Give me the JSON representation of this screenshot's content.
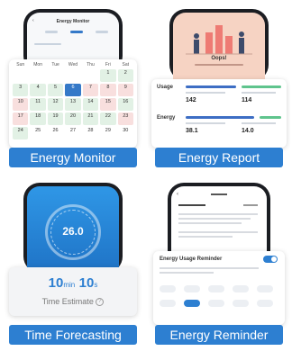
{
  "energy_monitor": {
    "caption": "Energy Monitor",
    "screen_title": "Energy Monitor",
    "weekdays": [
      "Sun",
      "Mon",
      "Tue",
      "Wed",
      "Thu",
      "Fri",
      "Sat"
    ],
    "days": [
      {
        "d": "",
        "s": "",
        "c": "none"
      },
      {
        "d": "",
        "s": "",
        "c": "none"
      },
      {
        "d": "",
        "s": "",
        "c": "none"
      },
      {
        "d": "",
        "s": "",
        "c": "none"
      },
      {
        "d": "",
        "s": "",
        "c": "none"
      },
      {
        "d": "1",
        "s": "",
        "c": "green"
      },
      {
        "d": "2",
        "s": "",
        "c": "green"
      },
      {
        "d": "3",
        "s": "",
        "c": "green"
      },
      {
        "d": "4",
        "s": "",
        "c": "green"
      },
      {
        "d": "5",
        "s": "",
        "c": "green"
      },
      {
        "d": "6",
        "s": "",
        "c": "blue"
      },
      {
        "d": "7",
        "s": "",
        "c": "red"
      },
      {
        "d": "8",
        "s": "",
        "c": "red"
      },
      {
        "d": "9",
        "s": "",
        "c": "red"
      },
      {
        "d": "10",
        "s": "",
        "c": "red"
      },
      {
        "d": "11",
        "s": "",
        "c": "green"
      },
      {
        "d": "12",
        "s": "",
        "c": "green"
      },
      {
        "d": "13",
        "s": "",
        "c": "green"
      },
      {
        "d": "14",
        "s": "",
        "c": "green"
      },
      {
        "d": "15",
        "s": "",
        "c": "red"
      },
      {
        "d": "16",
        "s": "",
        "c": "green"
      },
      {
        "d": "17",
        "s": "",
        "c": "red"
      },
      {
        "d": "18",
        "s": "",
        "c": "green"
      },
      {
        "d": "19",
        "s": "",
        "c": "green"
      },
      {
        "d": "20",
        "s": "",
        "c": "green"
      },
      {
        "d": "21",
        "s": "",
        "c": "green"
      },
      {
        "d": "22",
        "s": "",
        "c": "green"
      },
      {
        "d": "23",
        "s": "",
        "c": "red"
      },
      {
        "d": "24",
        "s": "",
        "c": "green"
      },
      {
        "d": "25",
        "s": "",
        "c": "none"
      },
      {
        "d": "26",
        "s": "",
        "c": "none"
      },
      {
        "d": "27",
        "s": "",
        "c": "none"
      },
      {
        "d": "28",
        "s": "",
        "c": "none"
      },
      {
        "d": "29",
        "s": "",
        "c": "none"
      },
      {
        "d": "30",
        "s": "",
        "c": "none"
      }
    ]
  },
  "energy_report": {
    "caption": "Energy Report",
    "banner_title": "Oops!",
    "usage_label": "Usage",
    "energy_label": "Energy",
    "usage_left_value": "142",
    "usage_right_value": "114",
    "energy_left_value": "38.1",
    "energy_right_value": "14.0"
  },
  "time_forecasting": {
    "caption": "Time Forecasting",
    "gauge_value": "26.0",
    "minutes_num": "10",
    "minutes_unit": "min",
    "seconds_num": "10",
    "seconds_unit": "s",
    "estimate_label": "Time Estimate",
    "info_icon_glyph": "?"
  },
  "energy_reminder": {
    "caption": "Energy Reminder",
    "card_title": "Energy Usage Reminder",
    "chip_states": [
      false,
      false,
      false,
      false,
      false,
      false,
      true,
      false,
      false,
      false
    ]
  },
  "colors": {
    "caption_bg": "#2d7fd1",
    "accent_blue": "#3579c8",
    "green_cell": "#e2f1e5",
    "red_cell": "#f8dfde",
    "report_bg": "#f6d3c3",
    "gauge_bg": "#2c8fe0"
  }
}
